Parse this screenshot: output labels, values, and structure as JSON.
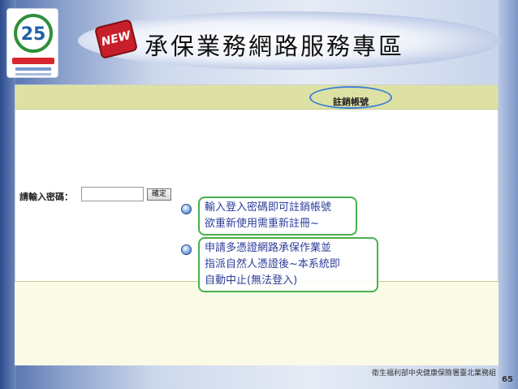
{
  "header": {
    "title": "承保業務網路服務專區",
    "new_badge": "NEW",
    "logo_text": "25"
  },
  "toolbar": {
    "cancel_account_link": "註銷帳號"
  },
  "form": {
    "password_label": "請輸入密碼：",
    "password_value": "",
    "confirm_button": "確定"
  },
  "notes": [
    {
      "lines": [
        "輸入登入密碼即可註銷帳號",
        "欲重新使用需重新註冊~"
      ]
    },
    {
      "lines": [
        "申請多憑證網路承保作業並",
        "指派自然人憑證後~本系統即",
        "自動中止(無法登入)"
      ]
    }
  ],
  "footer": {
    "organization": "衛生福利部中央健康保險署臺北業務組",
    "page_number": "65"
  },
  "colors": {
    "strip": "#dde2a4",
    "note_border": "#47b04b",
    "note_text": "#2c3e9a",
    "highlight_oval": "#3f7fd8"
  }
}
